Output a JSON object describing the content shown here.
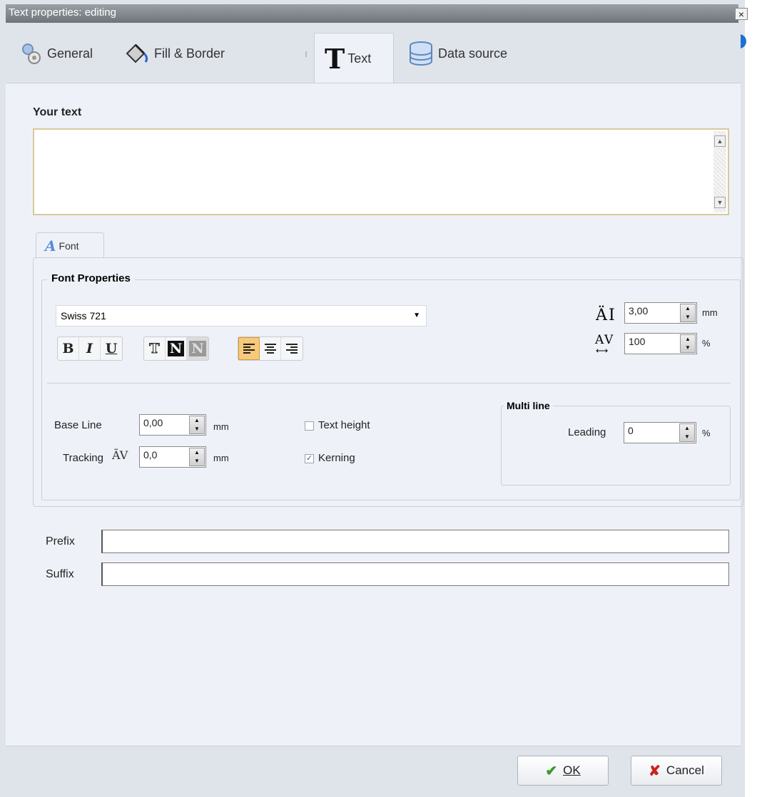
{
  "window": {
    "title": "Text properties: editing",
    "close_glyph": "×",
    "info_glyph": "i"
  },
  "tabs": [
    {
      "label": "General",
      "icon": "gear-icon"
    },
    {
      "label": "Fill & Border",
      "icon": "paint-bucket-icon"
    },
    {
      "label": "Text",
      "icon": "text-t-icon",
      "active": true
    },
    {
      "label": "Data source",
      "icon": "database-icon"
    }
  ],
  "your_text": {
    "label": "Your text",
    "value": ""
  },
  "font_tab": {
    "label": "Font"
  },
  "font_properties": {
    "title": "Font Properties",
    "font_name": "Swiss 721",
    "size_value": "3,00",
    "size_unit": "mm",
    "width_value": "100",
    "width_unit": "%"
  },
  "toolbar": {
    "bold": "B",
    "italic": "I",
    "underline": "U",
    "outline": "T",
    "inverse": "N",
    "negative": "N"
  },
  "base_line": {
    "label": "Base Line",
    "value": "0,00",
    "unit": "mm"
  },
  "tracking": {
    "label": "Tracking",
    "value": "0,0",
    "unit": "mm"
  },
  "text_height": {
    "label": "Text height",
    "checked": false
  },
  "kerning": {
    "label": "Kerning",
    "checked": true
  },
  "multi_line": {
    "title": "Multi line",
    "leading_label": "Leading",
    "leading_value": "0",
    "leading_unit": "%"
  },
  "prefix": {
    "label": "Prefix",
    "value": ""
  },
  "suffix": {
    "label": "Suffix",
    "value": ""
  },
  "buttons": {
    "ok": "OK",
    "cancel": "Cancel"
  },
  "colors": {
    "titlebar": "#7d8388",
    "panel": "#eef2f8",
    "active_toggle": "#f7c97a"
  }
}
